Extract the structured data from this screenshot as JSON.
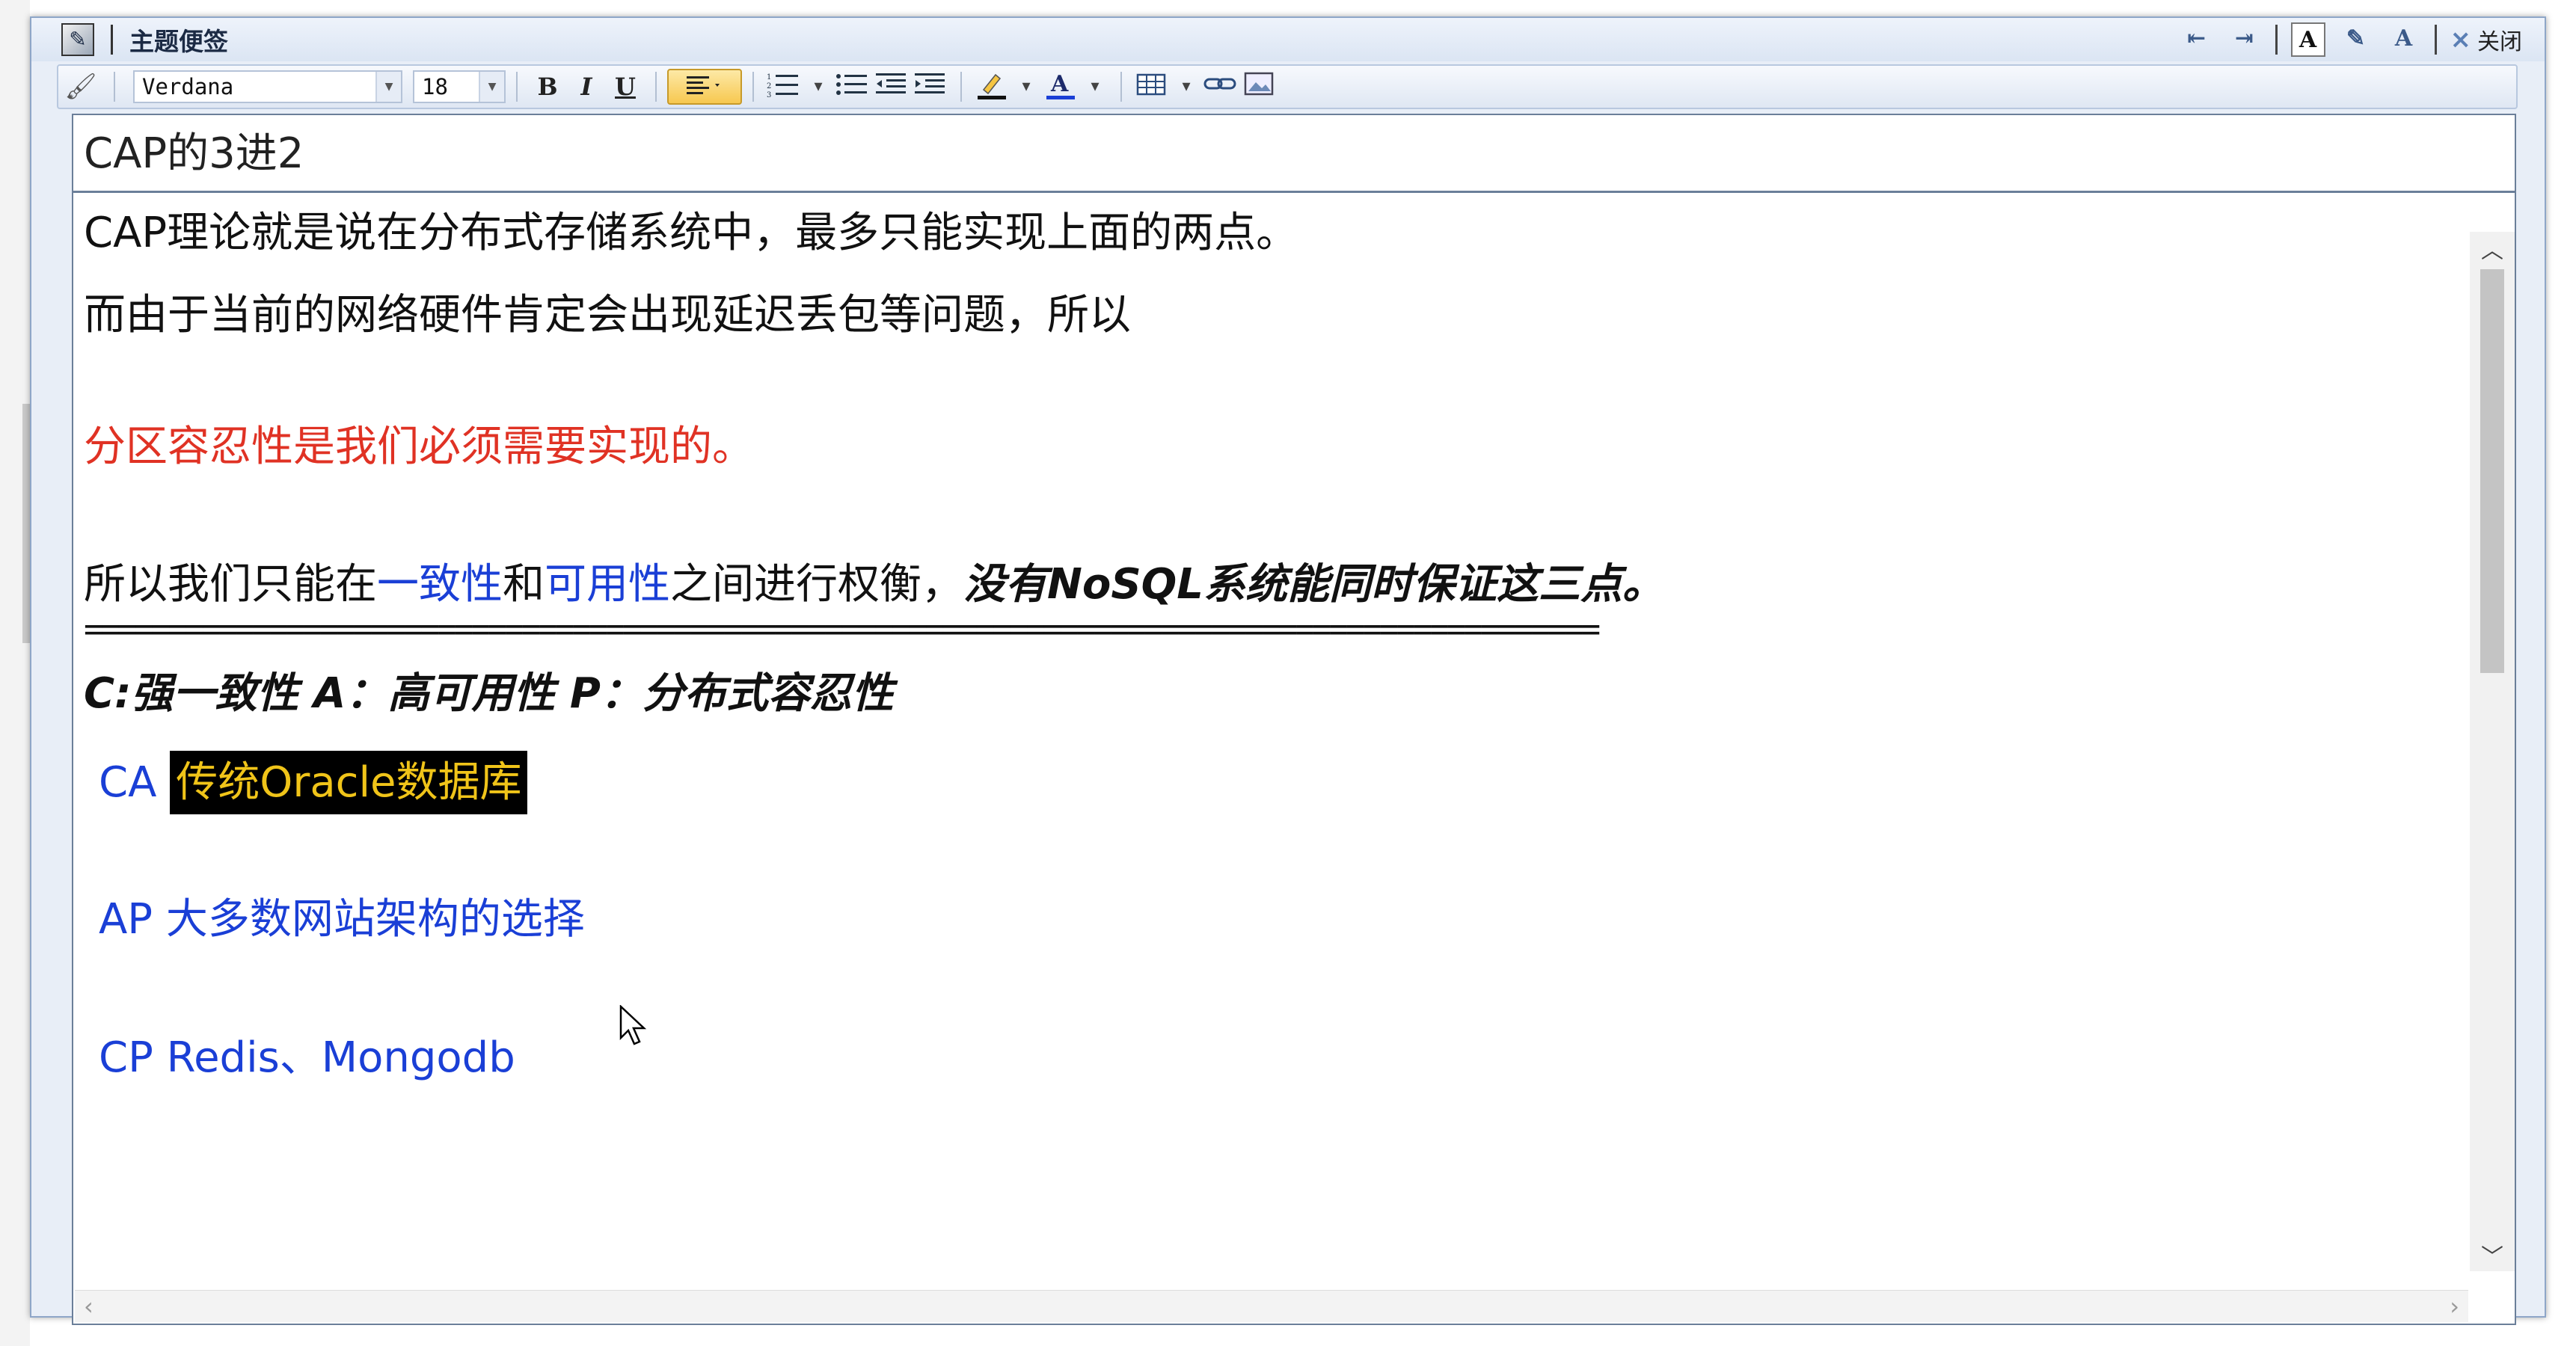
{
  "window": {
    "title": "主题便签",
    "close_label": "关闭",
    "title_icons": [
      "note-edit-icon",
      "export-icon",
      "import-icon",
      "font-a-icon",
      "pen-edit-icon",
      "font-style-icon"
    ]
  },
  "toolbar": {
    "font": "Verdana",
    "size": "18",
    "bold": "B",
    "italic": "I",
    "underline": "U",
    "font_color_glyph": "A",
    "buttons": [
      "clear-format-icon",
      "bold-button",
      "italic-button",
      "underline-button",
      "align-left-button",
      "numbered-list-button",
      "bullet-list-button",
      "outdent-button",
      "indent-button",
      "highlight-color-button",
      "font-color-button",
      "insert-table-button",
      "insert-link-button",
      "insert-image-button"
    ]
  },
  "note": {
    "subject": "CAP的3进2",
    "line1": "CAP理论就是说在分布式存储系统中，最多只能实现上面的两点。",
    "line2": "而由于当前的网络硬件肯定会出现延迟丢包等问题，所以",
    "line3_red": "分区容忍性是我们必须需要实现的。",
    "line4_a": "所以我们只能在",
    "line4_b": "一致性",
    "line4_c": "和",
    "line4_d": "可用性",
    "line4_e": "之间进行权衡，",
    "line4_f": "没有NoSQL系统能同时保证这三点。",
    "separator": "==========================================================================================",
    "legend": "C:强一致性 A：高可用性 P：分布式容忍性",
    "ca_label": "CA",
    "ca_text": "传统Oracle数据库",
    "ap": "AP 大多数网站架构的选择",
    "cp": "CP Redis、Mongodb"
  },
  "colors": {
    "red_text": "#e03224",
    "blue_text": "#1a3fd6",
    "highlight_bg": "#000000",
    "highlight_fg": "#f0c419",
    "frame": "#8ea6c8"
  }
}
